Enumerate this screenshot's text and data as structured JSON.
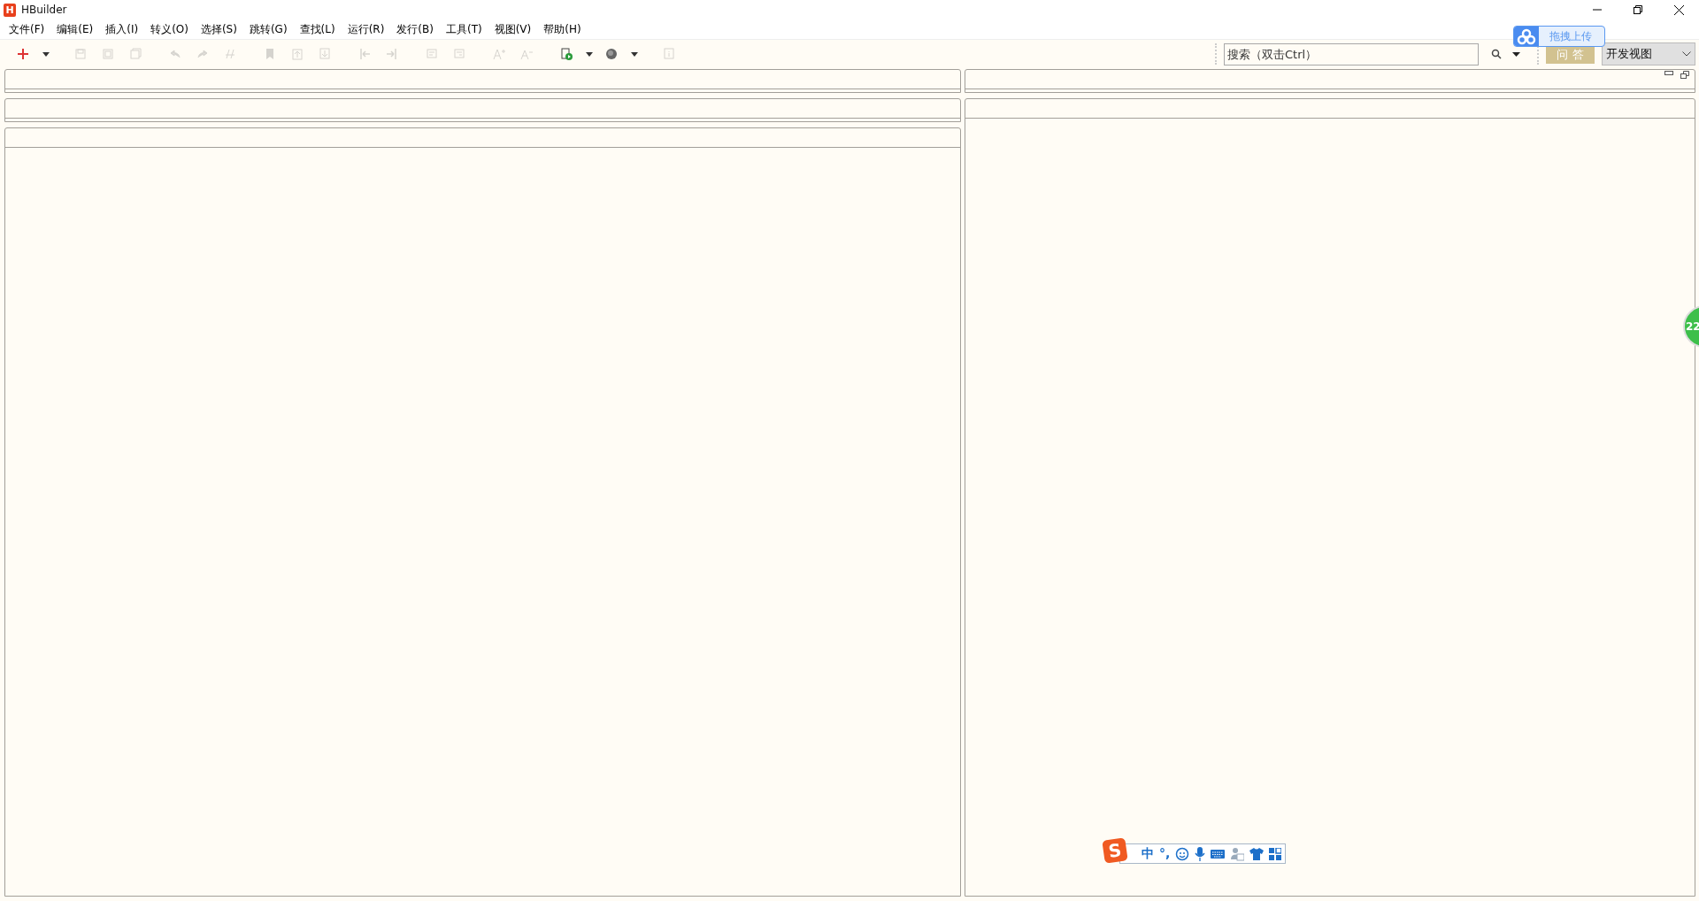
{
  "window": {
    "logo": "H",
    "title": "HBuilder"
  },
  "menu": [
    "文件(F)",
    "编辑(E)",
    "插入(I)",
    "转义(O)",
    "选择(S)",
    "跳转(G)",
    "查找(L)",
    "运行(R)",
    "发行(B)",
    "工具(T)",
    "视图(V)",
    "帮助(H)"
  ],
  "toolbar": [
    [
      {
        "disabled": false,
        "dropdown": true
      }
    ],
    [
      {
        "disabled": true,
        "dropdown": false
      },
      {
        "disabled": true,
        "dropdown": false
      },
      {
        "disabled": true,
        "dropdown": false
      }
    ],
    [
      {
        "disabled": true,
        "dropdown": false
      },
      {
        "disabled": true,
        "dropdown": false
      },
      {
        "disabled": true,
        "dropdown": false
      }
    ],
    [
      {
        "disabled": true,
        "dropdown": false
      },
      {
        "disabled": true,
        "dropdown": false
      },
      {
        "disabled": true,
        "dropdown": false
      }
    ],
    [
      {
        "disabled": true,
        "dropdown": false
      },
      {
        "disabled": true,
        "dropdown": false
      }
    ],
    [
      {
        "disabled": true,
        "dropdown": false
      },
      {
        "disabled": true,
        "dropdown": false
      }
    ],
    [
      {
        "disabled": true,
        "dropdown": false
      },
      {
        "disabled": true,
        "dropdown": false
      }
    ],
    [
      {
        "disabled": false,
        "dropdown": true
      },
      {
        "disabled": false,
        "dropdown": true
      }
    ],
    [
      {
        "disabled": true,
        "dropdown": false
      }
    ]
  ],
  "search": {
    "placeholder": "搜索（双击Ctrl）"
  },
  "qa_button": "问 答",
  "view_select": "开发视图",
  "upload_float": {
    "label": "拖拽上传"
  },
  "side_badge": "22",
  "ime_bar": {
    "logo": "S",
    "mode": "中",
    "punctuation": "°,"
  }
}
